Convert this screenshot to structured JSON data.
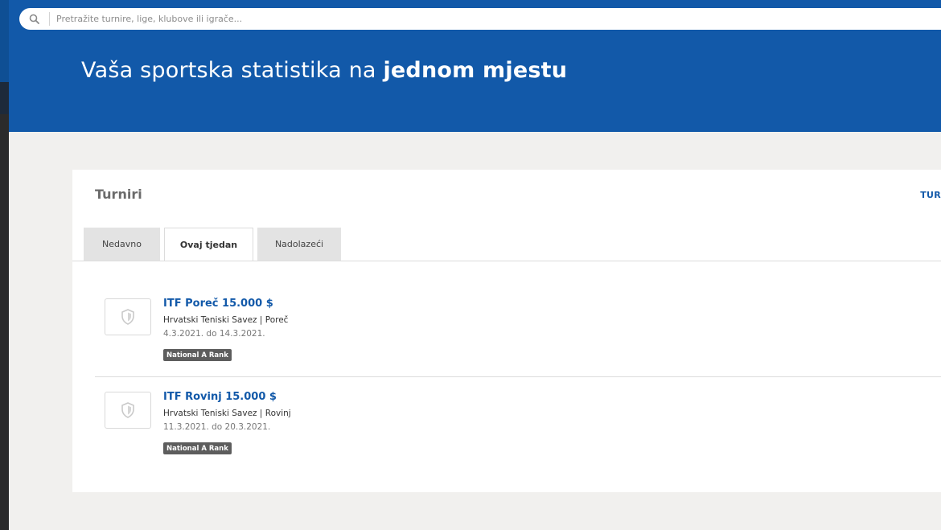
{
  "search": {
    "placeholder": "Pretražite turnire, lige, klubove ili igrače..."
  },
  "hero": {
    "title_regular": "Vaša sportska statistika na ",
    "title_bold": "jednom mjestu"
  },
  "card": {
    "title": "Turniri",
    "link_label": "TUR"
  },
  "tabs": [
    {
      "label": "Nedavno",
      "active": false
    },
    {
      "label": "Ovaj tjedan",
      "active": true
    },
    {
      "label": "Nadolazeći",
      "active": false
    }
  ],
  "tournaments": [
    {
      "title": "ITF Poreč 15.000 $",
      "subtitle": "Hrvatski Teniski Savez | Poreč",
      "dates": "4.3.2021. do 14.3.2021.",
      "badge": "National A Rank"
    },
    {
      "title": "ITF Rovinj 15.000 $",
      "subtitle": "Hrvatski Teniski Savez | Rovinj",
      "dates": "11.3.2021. do 20.3.2021.",
      "badge": "National A Rank"
    }
  ],
  "colors": {
    "brand": "#1259a9",
    "background": "#f1f0ee",
    "badge": "#5d5d5d"
  }
}
